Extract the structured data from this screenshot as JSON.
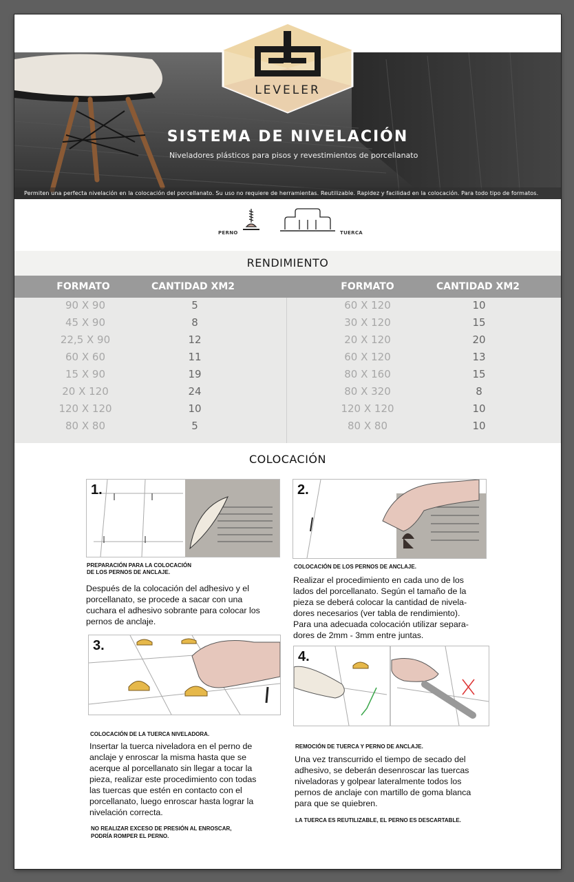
{
  "brand": {
    "logo_text": "LEVELER"
  },
  "hero": {
    "title": "SISTEMA DE NIVELACIÓN",
    "subtitle": "Niveladores plásticos para pisos y revestimientos de porcellanato",
    "strip": "Permiten una perfecta nivelación en la colocación del porcellanato. Su uso no requiere de herramientas. Reutilizable.  Rapidez y facilidad en la colocación.  Para todo tipo de formatos."
  },
  "parts": {
    "left_label": "PERNO",
    "right_label": "TUERCA"
  },
  "rendimiento": {
    "title": "RENDIMIENTO",
    "headers": {
      "format": "FORMATO",
      "qty": "CANTIDAD XM2"
    },
    "left_rows": [
      {
        "format": "90 X 90",
        "qty": "5"
      },
      {
        "format": "45 X 90",
        "qty": "8"
      },
      {
        "format": "22,5 X 90",
        "qty": "12"
      },
      {
        "format": "60 X 60",
        "qty": "11"
      },
      {
        "format": "15 X 90",
        "qty": "19"
      },
      {
        "format": "20 X 120",
        "qty": "24"
      },
      {
        "format": "120 X 120",
        "qty": "10"
      },
      {
        "format": "80 X 80",
        "qty": "5"
      }
    ],
    "right_rows": [
      {
        "format": "60 X 120",
        "qty": "10"
      },
      {
        "format": "30 X 120",
        "qty": "15"
      },
      {
        "format": "20 X 120",
        "qty": "20"
      },
      {
        "format": "60 X 120",
        "qty": "13"
      },
      {
        "format": "80 X 160",
        "qty": "15"
      },
      {
        "format": "80 X 320",
        "qty": "8"
      },
      {
        "format": "120 X 120",
        "qty": "10"
      },
      {
        "format": "80 X 80",
        "qty": "10"
      }
    ]
  },
  "colocacion": {
    "title": "COLOCACIÓN",
    "steps": [
      {
        "num": "1.",
        "head_lines": [
          "PREPARACIÓN PARA LA COLOCACIÓN",
          "DE LOS PERNOS DE ANCLAJE."
        ],
        "body_lines": [
          "Después de la colocación del adhesivo y el",
          "porcellanato, se procede a sacar con una",
          "cuchara el adhesivo sobrante para colocar los",
          "pernos de anclaje."
        ]
      },
      {
        "num": "2.",
        "head_lines": [
          "COLOCACIÓN DE LOS PERNOS DE ANCLAJE."
        ],
        "body_lines": [
          "Realizar el procedimiento en cada uno de los",
          "lados del porcellanato. Según el tamaño de la",
          "pieza se deberá colocar la cantidad de nivela-",
          "dores necesarios (ver tabla de rendimiento).",
          "Para una adecuada colocación utilizar separa-",
          "dores de 2mm - 3mm entre juntas."
        ]
      },
      {
        "num": "3.",
        "head_lines": [
          "COLOCACIÓN DE LA TUERCA NIVELADORA."
        ],
        "body_lines": [
          "Insertar la tuerca niveladora en el perno de",
          "anclaje y enroscar la misma hasta que se",
          "acerque al porcellanato sin llegar a tocar la",
          "pieza, realizar este procedimiento con todas",
          "las tuercas que estén en contacto con el",
          "porcellanato, luego enroscar hasta lograr la",
          "nivelación correcta."
        ],
        "note_lines": [
          "NO REALIZAR EXCESO DE PRESIÓN AL ENROSCAR,",
          "PODRÍA ROMPER EL PERNO."
        ]
      },
      {
        "num": "4.",
        "head_lines": [
          "REMOCIÓN DE TUERCA Y PERNO DE ANCLAJE."
        ],
        "body_lines": [
          "Una vez transcurrido el tiempo de secado del",
          "adhesivo, se deberán desenroscar las tuercas",
          "niveladoras y golpear lateralmente todos los",
          "pernos de anclaje con martillo de goma blanca",
          "para que se quiebren."
        ],
        "note_lines": [
          "LA TUERCA ES REUTILIZABLE, EL PERNO ES DESCARTABLE."
        ]
      }
    ]
  }
}
